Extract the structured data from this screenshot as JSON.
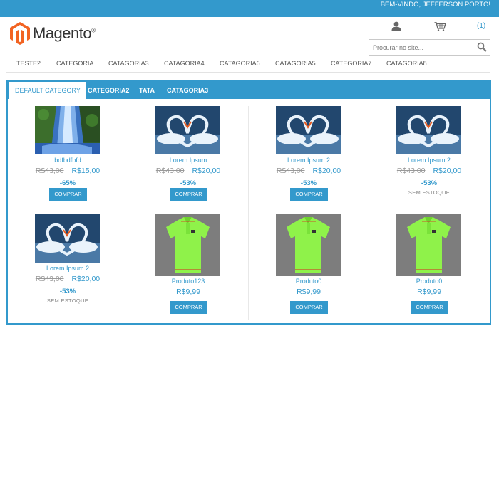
{
  "header": {
    "welcome": "BEM-VINDO, JEFFERSON PORTO!",
    "logo_text": "Magento",
    "cart_count": "(1)",
    "search_placeholder": "Procurar no site..."
  },
  "nav": [
    "TESTE2",
    "CATEGORIA",
    "CATAGORIA3",
    "CATAGORIA4",
    "CATAGORIA6",
    "CATAGORIA5",
    "CATEGORIA7",
    "CATAGORIA8"
  ],
  "tabs": [
    "DEFAULT CATEGORY",
    "CATEGORIA2",
    "TATA",
    "CATAGORIA3"
  ],
  "products": [
    {
      "name": "bdfbdfbfd",
      "image": "waterfall",
      "old_price": "R$43,00",
      "price": "R$15,00",
      "discount": "-65%",
      "stock": "",
      "buy_label": "COMPRAR"
    },
    {
      "name": "Lorem Ipsum",
      "image": "swans",
      "old_price": "R$43,00",
      "price": "R$20,00",
      "discount": "-53%",
      "stock": "",
      "buy_label": "COMPRAR"
    },
    {
      "name": "Lorem Ipsum 2",
      "image": "swans",
      "old_price": "R$43,00",
      "price": "R$20,00",
      "discount": "-53%",
      "stock": "",
      "buy_label": "COMPRAR"
    },
    {
      "name": "Lorem Ipsum 2",
      "image": "swans",
      "old_price": "R$43,00",
      "price": "R$20,00",
      "discount": "-53%",
      "stock": "SEM ESTOQUE",
      "buy_label": ""
    },
    {
      "name": "Lorem Ipsum 2",
      "image": "swans",
      "old_price": "R$43,00",
      "price": "R$20,00",
      "discount": "-53%",
      "stock": "SEM ESTOQUE",
      "buy_label": ""
    },
    {
      "name": "Produto123",
      "image": "polo-shirt",
      "old_price": "",
      "price": "R$9,99",
      "discount": "",
      "stock": "",
      "buy_label": "COMPRAR"
    },
    {
      "name": "Produto0",
      "image": "polo-shirt",
      "old_price": "",
      "price": "R$9,99",
      "discount": "",
      "stock": "",
      "buy_label": "COMPRAR"
    },
    {
      "name": "Produto0",
      "image": "polo-shirt",
      "old_price": "",
      "price": "R$9,99",
      "discount": "",
      "stock": "",
      "buy_label": "COMPRAR"
    }
  ],
  "colors": {
    "accent": "#3399cc",
    "logo_orange": "#f26322"
  }
}
